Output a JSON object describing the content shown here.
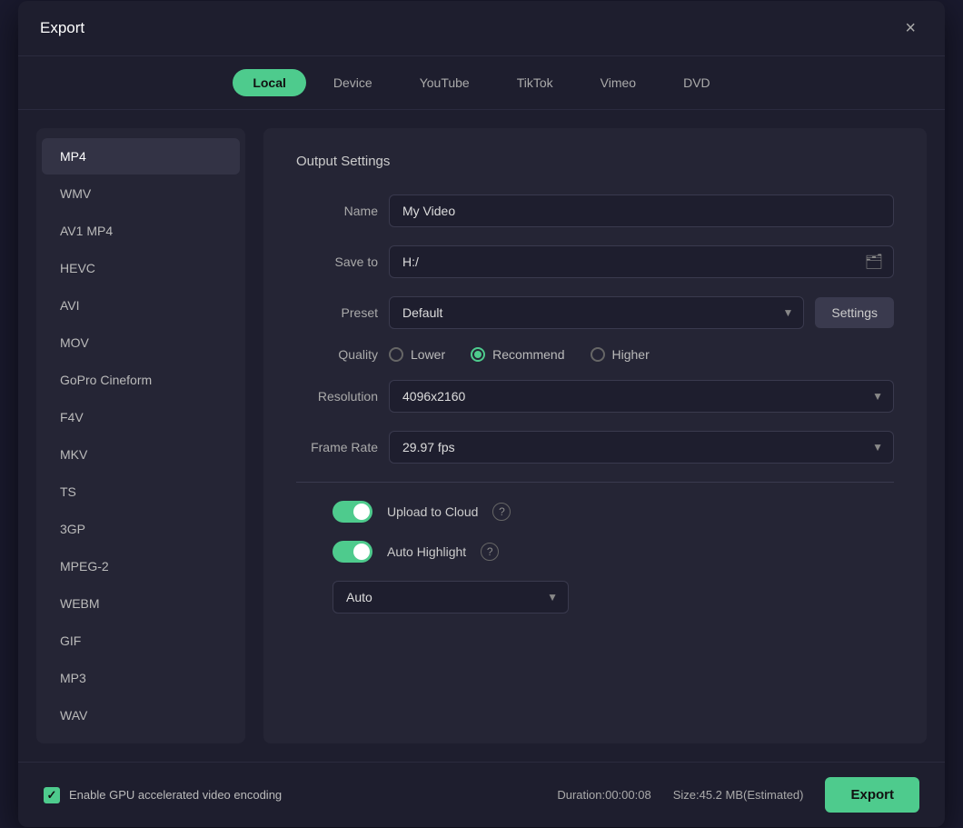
{
  "dialog": {
    "title": "Export",
    "close_label": "×"
  },
  "tabs": [
    {
      "id": "local",
      "label": "Local",
      "active": true
    },
    {
      "id": "device",
      "label": "Device",
      "active": false
    },
    {
      "id": "youtube",
      "label": "YouTube",
      "active": false
    },
    {
      "id": "tiktok",
      "label": "TikTok",
      "active": false
    },
    {
      "id": "vimeo",
      "label": "Vimeo",
      "active": false
    },
    {
      "id": "dvd",
      "label": "DVD",
      "active": false
    }
  ],
  "formats": [
    {
      "id": "mp4",
      "label": "MP4",
      "selected": true
    },
    {
      "id": "wmv",
      "label": "WMV",
      "selected": false
    },
    {
      "id": "av1mp4",
      "label": "AV1 MP4",
      "selected": false
    },
    {
      "id": "hevc",
      "label": "HEVC",
      "selected": false
    },
    {
      "id": "avi",
      "label": "AVI",
      "selected": false
    },
    {
      "id": "mov",
      "label": "MOV",
      "selected": false
    },
    {
      "id": "gopro",
      "label": "GoPro Cineform",
      "selected": false
    },
    {
      "id": "f4v",
      "label": "F4V",
      "selected": false
    },
    {
      "id": "mkv",
      "label": "MKV",
      "selected": false
    },
    {
      "id": "ts",
      "label": "TS",
      "selected": false
    },
    {
      "id": "3gp",
      "label": "3GP",
      "selected": false
    },
    {
      "id": "mpeg2",
      "label": "MPEG-2",
      "selected": false
    },
    {
      "id": "webm",
      "label": "WEBM",
      "selected": false
    },
    {
      "id": "gif",
      "label": "GIF",
      "selected": false
    },
    {
      "id": "mp3",
      "label": "MP3",
      "selected": false
    },
    {
      "id": "wav",
      "label": "WAV",
      "selected": false
    }
  ],
  "output_settings": {
    "section_title": "Output Settings",
    "name_label": "Name",
    "name_value": "My Video",
    "saveto_label": "Save to",
    "saveto_value": "H:/",
    "preset_label": "Preset",
    "preset_value": "Default",
    "settings_btn_label": "Settings",
    "quality_label": "Quality",
    "quality_options": [
      {
        "id": "lower",
        "label": "Lower",
        "checked": false
      },
      {
        "id": "recommend",
        "label": "Recommend",
        "checked": true
      },
      {
        "id": "higher",
        "label": "Higher",
        "checked": false
      }
    ],
    "resolution_label": "Resolution",
    "resolution_value": "4096x2160",
    "framerate_label": "Frame Rate",
    "framerate_value": "29.97 fps",
    "upload_cloud_label": "Upload to Cloud",
    "upload_cloud_enabled": true,
    "auto_highlight_label": "Auto Highlight",
    "auto_highlight_enabled": true,
    "auto_select_value": "Auto"
  },
  "footer": {
    "gpu_label": "Enable GPU accelerated video encoding",
    "duration_label": "Duration:00:00:08",
    "size_label": "Size:45.2 MB(Estimated)",
    "export_btn_label": "Export"
  }
}
